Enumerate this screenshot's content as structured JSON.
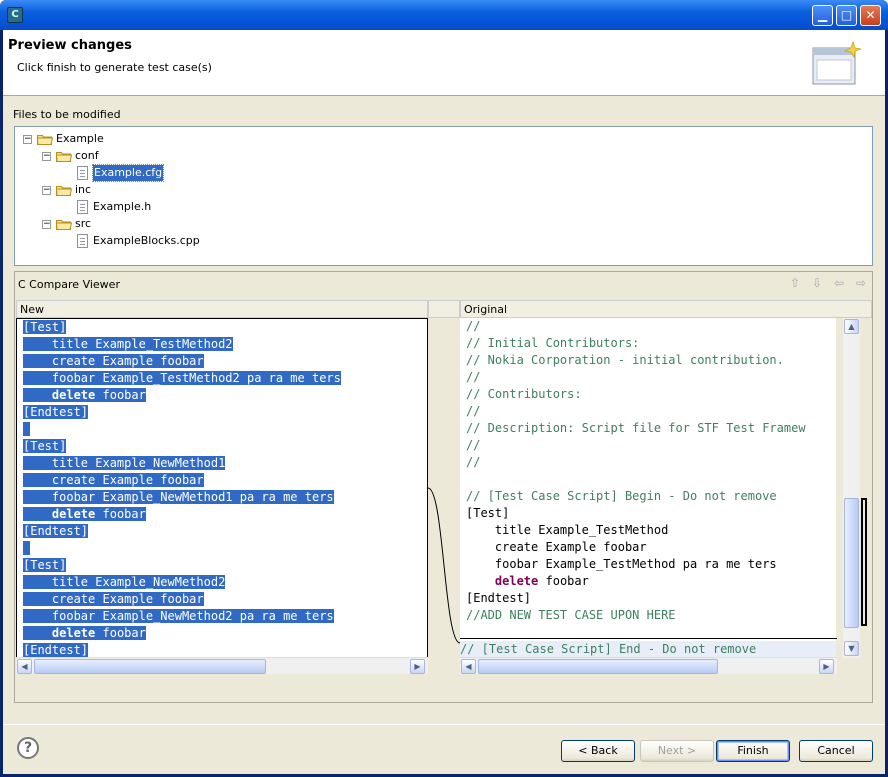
{
  "window": {
    "icon_label": "C",
    "buttons": {
      "minimize": "▁",
      "maximize": "□",
      "close": "✕"
    }
  },
  "header": {
    "title": "Preview changes",
    "subtitle": "Click finish to generate test case(s)"
  },
  "files": {
    "label": "Files to be modified",
    "tree": [
      {
        "label": "Example",
        "type": "folder",
        "expanded": true,
        "depth": 0
      },
      {
        "label": "conf",
        "type": "folder",
        "expanded": true,
        "depth": 1
      },
      {
        "label": "Example.cfg",
        "type": "file",
        "depth": 2,
        "selected": true
      },
      {
        "label": "inc",
        "type": "folder",
        "expanded": true,
        "depth": 1
      },
      {
        "label": "Example.h",
        "type": "file",
        "depth": 2
      },
      {
        "label": "src",
        "type": "folder",
        "expanded": true,
        "depth": 1
      },
      {
        "label": "ExampleBlocks.cpp",
        "type": "file",
        "depth": 2
      }
    ]
  },
  "compare": {
    "title": "C Compare Viewer",
    "left_header": "New",
    "right_header": "Original",
    "left_lines": [
      {
        "text": "[Test]",
        "hl": true
      },
      {
        "text": "    title Example_TestMethod2",
        "hl": true
      },
      {
        "text": "    create Example foobar",
        "hl": true
      },
      {
        "text": "    foobar Example_TestMethod2 pa ra me ters",
        "hl": true
      },
      {
        "text": "    delete foobar",
        "hl": true,
        "kw": "delete"
      },
      {
        "text": "[Endtest]",
        "hl": true
      },
      {
        "text": " ",
        "hl": true
      },
      {
        "text": "[Test]",
        "hl": true
      },
      {
        "text": "    title Example_NewMethod1",
        "hl": true
      },
      {
        "text": "    create Example foobar",
        "hl": true
      },
      {
        "text": "    foobar Example_NewMethod1 pa ra me ters",
        "hl": true
      },
      {
        "text": "    delete foobar",
        "hl": true,
        "kw": "delete"
      },
      {
        "text": "[Endtest]",
        "hl": true
      },
      {
        "text": " ",
        "hl": true
      },
      {
        "text": "[Test]",
        "hl": true
      },
      {
        "text": "    title Example_NewMethod2",
        "hl": true
      },
      {
        "text": "    create Example foobar",
        "hl": true
      },
      {
        "text": "    foobar Example_NewMethod2 pa ra me ters",
        "hl": true
      },
      {
        "text": "    delete foobar",
        "hl": true,
        "kw": "delete"
      },
      {
        "text": "[Endtest]",
        "hl": true
      }
    ],
    "right_lines": [
      {
        "text": "//",
        "cls": "cm"
      },
      {
        "text": "// Initial Contributors:",
        "cls": "cm"
      },
      {
        "text": "// Nokia Corporation - initial contribution.",
        "cls": "cm"
      },
      {
        "text": "//",
        "cls": "cm"
      },
      {
        "text": "// Contributors:",
        "cls": "cm"
      },
      {
        "text": "//",
        "cls": "cm"
      },
      {
        "text": "// Description: Script file for STF Test Framew",
        "cls": "cm"
      },
      {
        "text": "//",
        "cls": "cm"
      },
      {
        "text": "//",
        "cls": "cm"
      },
      {
        "text": " ",
        "cls": ""
      },
      {
        "text": "// [Test Case Script] Begin - Do not remove",
        "cls": "cm"
      },
      {
        "text": "[Test]",
        "cls": ""
      },
      {
        "text": "    title Example_TestMethod",
        "cls": ""
      },
      {
        "text": "    create Example foobar",
        "cls": ""
      },
      {
        "text": "    foobar Example_TestMethod pa ra me ters",
        "cls": ""
      },
      {
        "text": "    delete foobar",
        "cls": "",
        "kw": "delete"
      },
      {
        "text": "[Endtest]",
        "cls": ""
      },
      {
        "text": "//ADD NEW TEST CASE UPON HERE",
        "cls": "cm"
      },
      {
        "text": " ",
        "cls": ""
      },
      {
        "text": "// [Test Case Script] End - Do not remove",
        "cls": "cm",
        "bg": true
      }
    ]
  },
  "buttons": {
    "back": "< Back",
    "next": "Next >",
    "finish": "Finish",
    "cancel": "Cancel"
  },
  "help": "?"
}
